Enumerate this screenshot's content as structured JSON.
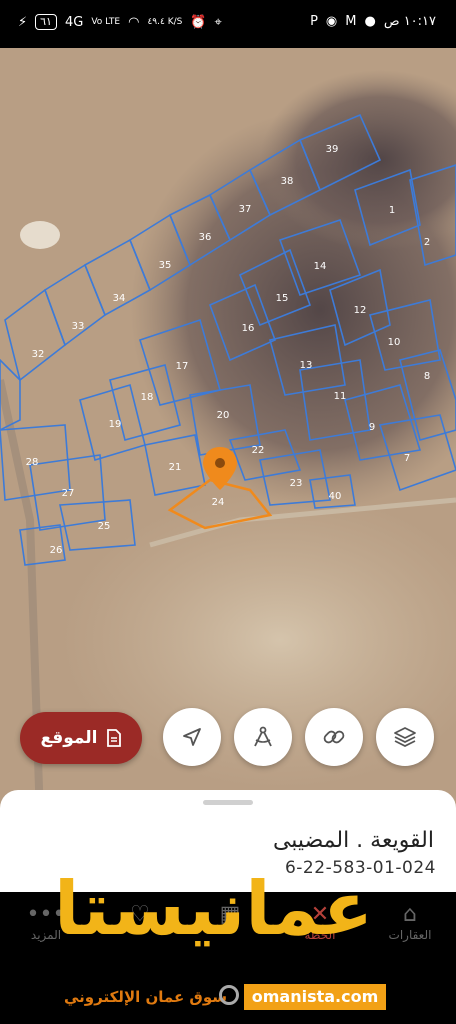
{
  "status_bar": {
    "time": "١٠:١٧ ص",
    "battery": "٦١",
    "network": "4G",
    "volte": "Vo LTE",
    "speed": "٤٩.٤ K/S"
  },
  "map": {
    "parcels": [
      "39",
      "38",
      "37",
      "36",
      "35",
      "34",
      "33",
      "32",
      "1",
      "2",
      "14",
      "15",
      "16",
      "12",
      "10",
      "13",
      "17",
      "18",
      "19",
      "20",
      "11",
      "9",
      "8",
      "22",
      "7",
      "21",
      "23",
      "24",
      "40",
      "28",
      "27",
      "25",
      "26"
    ],
    "selected_parcel": "24",
    "colors": {
      "boundary": "#3d7bd8",
      "selected": "#f08a1c",
      "pin": "#f08a1c"
    }
  },
  "actions": {
    "location_label": "الموقع",
    "buttons": [
      "navigate-icon",
      "measure-icon",
      "link-icon",
      "layers-icon"
    ]
  },
  "sheet": {
    "place_name": "القويعة . المضيبى",
    "parcel_id": "6-22-583-01-024"
  },
  "nav": {
    "items": [
      "العقارات",
      "الخطة",
      "",
      "",
      "المزيد"
    ]
  },
  "watermark": {
    "logo_text": "عمانيستا",
    "tagline": "سوق عمان الإلكتروني",
    "url": "omanista.com"
  }
}
